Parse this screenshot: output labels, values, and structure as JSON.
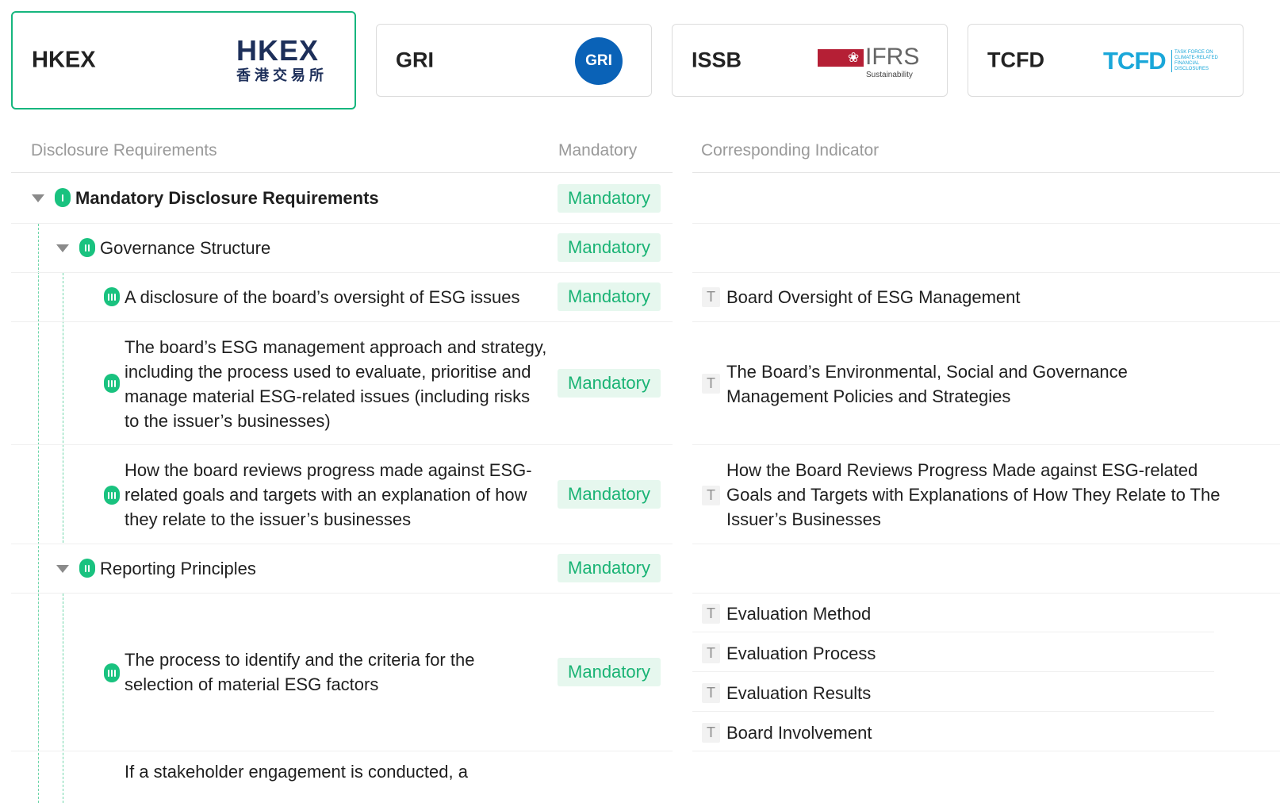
{
  "tabs": [
    {
      "label": "HKEX",
      "active": true,
      "logo": {
        "text": "HKEX",
        "sub": "香港交易所"
      }
    },
    {
      "label": "GRI",
      "active": false,
      "logo": {
        "text": "GRI"
      }
    },
    {
      "label": "ISSB",
      "active": false,
      "logo": {
        "text": "IFRS",
        "sub": "Sustainability"
      }
    },
    {
      "label": "TCFD",
      "active": false,
      "logo": {
        "text": "TCFD",
        "sub_lines": [
          "TASK FORCE ON",
          "CLIMATE-RELATED",
          "FINANCIAL",
          "DISCLOSURES"
        ]
      }
    }
  ],
  "columns": {
    "requirements": "Disclosure Requirements",
    "mandatory": "Mandatory",
    "indicator": "Corresponding Indicator"
  },
  "rows": [
    {
      "label": "Mandatory Disclosure Requirements",
      "badge": "Mandatory",
      "indicators": []
    },
    {
      "label": "Governance Structure",
      "badge": "Mandatory",
      "indicators": []
    },
    {
      "label": "A disclosure of the board’s oversight of ESG issues",
      "badge": "Mandatory",
      "indicators": [
        "Board Oversight of ESG Management"
      ]
    },
    {
      "label_lines": [
        "The board’s ESG management approach and strategy,",
        "including the process used to evaluate, prioritise and",
        "manage material ESG-related issues (including risks",
        "to the issuer’s businesses)"
      ],
      "badge": "Mandatory",
      "indicator_lines": [
        "The Board’s Environmental, Social and Governance",
        "Management Policies and Strategies"
      ]
    },
    {
      "label_lines": [
        "How the board reviews progress made against ESG-",
        "related goals and targets with an explanation of how",
        "they relate to the issuer’s businesses"
      ],
      "badge": "Mandatory",
      "indicator_lines": [
        "How the Board Reviews Progress Made against ESG-related",
        "Goals and Targets with Explanations of How They Relate to The",
        "Issuer’s Businesses"
      ]
    },
    {
      "label": "Reporting Principles",
      "badge": "Mandatory",
      "indicators": []
    },
    {
      "label_lines": [
        "The process to identify and the criteria for the",
        "selection of material ESG factors"
      ],
      "badge": "Mandatory",
      "indicators": [
        "Evaluation Method",
        "Evaluation Process",
        "Evaluation Results",
        "Board Involvement"
      ]
    },
    {
      "label": "If a stakeholder engagement is conducted, a"
    }
  ],
  "t_icon_glyph": "T",
  "colors": {
    "accent": "#19c27f",
    "badge_bg": "#e6f7ee",
    "badge_text": "#19b374",
    "gri_blue": "#0a62b7",
    "ifrs_red": "#b51f35",
    "tcfd_blue": "#1aa7d9",
    "hkex_navy": "#1d2f5a",
    "hkex_red": "#e2231a"
  }
}
